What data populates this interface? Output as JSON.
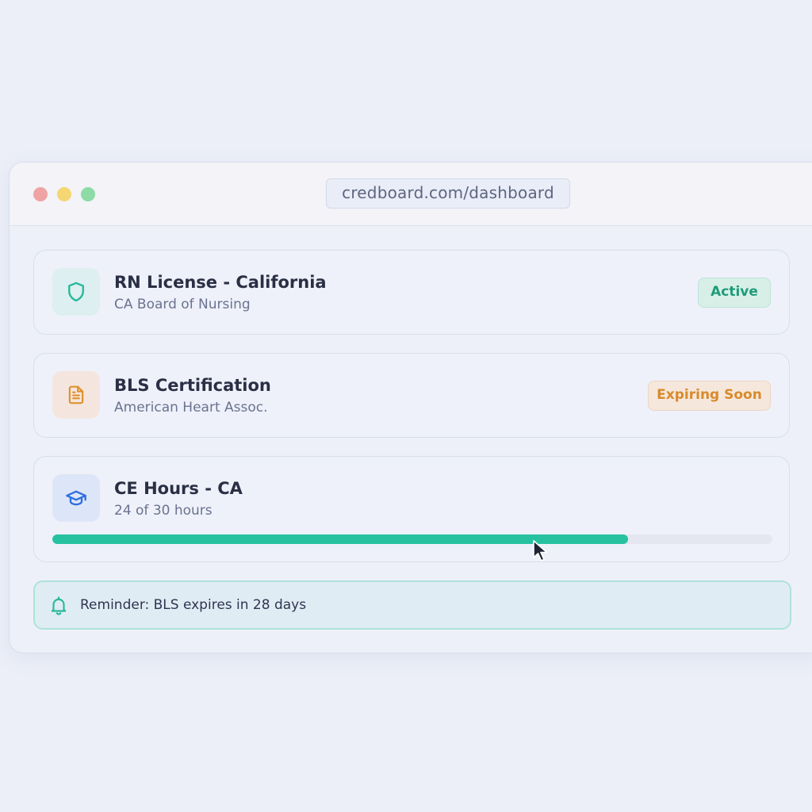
{
  "browser": {
    "url": "credboard.com/dashboard"
  },
  "credentials": [
    {
      "title": "RN License - California",
      "subtitle": "CA Board of Nursing",
      "status": "Active",
      "icon": "shield-icon",
      "status_color": "#1f9b78"
    },
    {
      "title": "BLS Certification",
      "subtitle": "American Heart Assoc.",
      "status": "Expiring Soon",
      "icon": "document-icon",
      "status_color": "#d98a2a"
    },
    {
      "title": "CE Hours - CA",
      "subtitle": "24 of 30 hours",
      "icon": "graduation-cap-icon",
      "progress_fraction": 0.8,
      "progress_color": "#26c2a0"
    }
  ],
  "reminder": {
    "text": "Reminder: BLS expires in 28 days",
    "icon": "bell-icon"
  },
  "colors": {
    "accent": "#26c2a0",
    "warning": "#d98a2a"
  }
}
